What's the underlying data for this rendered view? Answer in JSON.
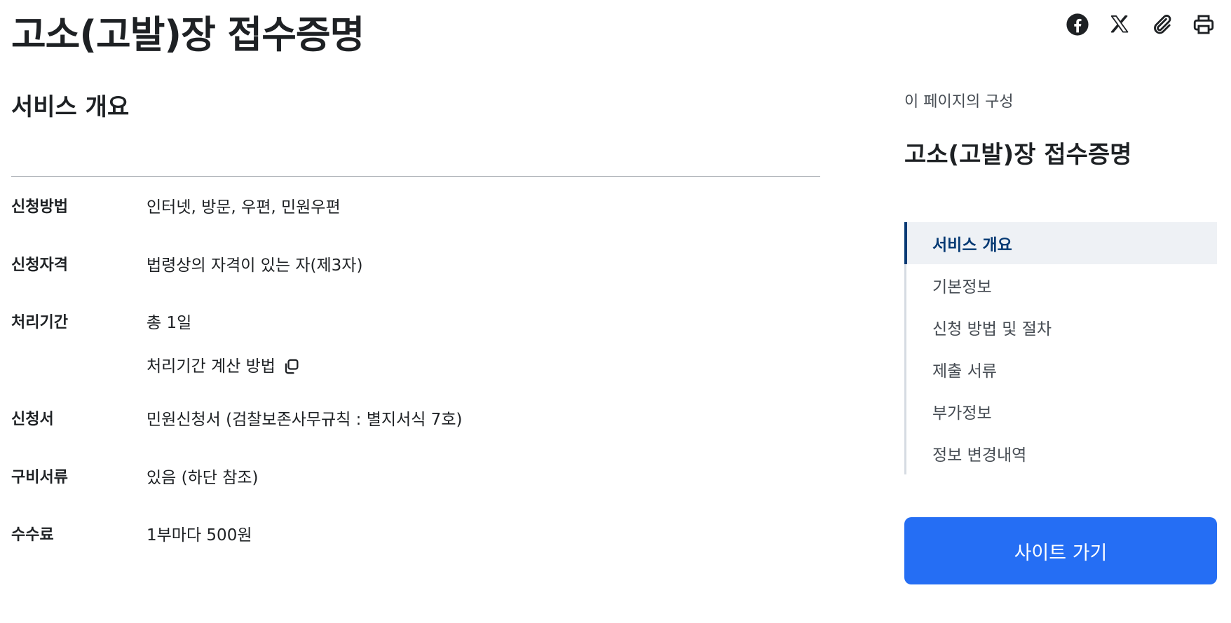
{
  "page": {
    "title": "고소(고발)장 접수증명"
  },
  "share_tools": {
    "icons": [
      "facebook-icon",
      "x-icon",
      "link-icon",
      "print-icon"
    ]
  },
  "main": {
    "section_title": "서비스 개요",
    "rows": [
      {
        "label": "신청방법",
        "value": "인터넷, 방문, 우편, 민원우편"
      },
      {
        "label": "신청자격",
        "value": "법령상의 자격이 있는 자(제3자)"
      },
      {
        "label": "처리기간",
        "value": "총 1일",
        "sub_link": "처리기간 계산 방법"
      },
      {
        "label": "신청서",
        "value": "민원신청서 (검찰보존사무규칙 : 별지서식 7호)"
      },
      {
        "label": "구비서류",
        "value": "있음 (하단 참조)"
      },
      {
        "label": "수수료",
        "value": "1부마다 500원"
      }
    ]
  },
  "aside": {
    "caption": "이 페이지의 구성",
    "title": "고소(고발)장 접수증명",
    "toc": [
      {
        "label": "서비스 개요",
        "active": true
      },
      {
        "label": "기본정보",
        "active": false
      },
      {
        "label": "신청 방법 및 절차",
        "active": false
      },
      {
        "label": "제출 서류",
        "active": false
      },
      {
        "label": "부가정보",
        "active": false
      },
      {
        "label": "정보 변경내역",
        "active": false
      }
    ],
    "button_label": "사이트 가기"
  },
  "colors": {
    "text": "#1e2124",
    "accent_navy": "#063a74",
    "button_blue": "#256ef4",
    "toc_active_bg": "#eef1f5"
  }
}
